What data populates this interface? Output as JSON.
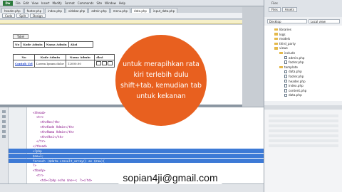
{
  "app": {
    "logo": "Dw",
    "menu": [
      "File",
      "Edit",
      "View",
      "Insert",
      "Modify",
      "Format",
      "Commands",
      "Site",
      "Window",
      "Help"
    ]
  },
  "tabs": [
    "header.php",
    "footer.php",
    "index.php",
    "sidebar.php",
    "admin.php",
    "menu.php",
    "data.php",
    "input_data.php"
  ],
  "active_tab_index": 6,
  "toolbar": {
    "code_label": "Code",
    "split_label": "Split",
    "design_label": "Design"
  },
  "design": {
    "label_box": "Tabel",
    "table1_headers": [
      "No",
      "Kode Admin",
      "Nama Admin",
      "Aksi"
    ],
    "table2_headers": [
      "No",
      "Kode Admin",
      "Nama Admin",
      "Aksi"
    ],
    "table2_row": [
      "Contoh Url",
      "Lorem Ipsum dolor",
      "12000.00",
      "",
      "",
      ""
    ]
  },
  "code_lines": [
    {
      "n": "",
      "text": "<thead>",
      "sel": false
    },
    {
      "n": "",
      "text": "  <tr>",
      "sel": false
    },
    {
      "n": "",
      "text": "    <th>No</th>",
      "sel": false
    },
    {
      "n": "",
      "text": "    <th>Kode Admin</th>",
      "sel": false
    },
    {
      "n": "",
      "text": "    <th>Nama Admin</th>",
      "sel": false
    },
    {
      "n": "",
      "text": "    <th>Aksi</th>",
      "sel": false
    },
    {
      "n": "",
      "text": "  </tr>",
      "sel": false
    },
    {
      "n": "",
      "text": "</thead>",
      "sel": false
    },
    {
      "n": "",
      "text": "<?php",
      "sel": true
    },
    {
      "n": "",
      "text": "$no=1;",
      "sel": true
    },
    {
      "n": "",
      "text": "foreach ($data->result_array() as $row){",
      "sel": true
    },
    {
      "n": "",
      "text": "?>",
      "sel": false
    },
    {
      "n": "",
      "text": "<tbody>",
      "sel": false
    },
    {
      "n": "",
      "text": "  <tr>",
      "sel": false
    },
    {
      "n": "",
      "text": "    <td><?php echo $no++; ?></td>",
      "sel": false
    }
  ],
  "files_panel": {
    "title": "Files",
    "tabs": [
      "Files",
      "Assets"
    ],
    "site_select": "Desktop",
    "view_select": "Local view",
    "tree": [
      {
        "name": "libraries",
        "kind": "folder",
        "indent": 2
      },
      {
        "name": "logs",
        "kind": "folder",
        "indent": 2
      },
      {
        "name": "models",
        "kind": "folder",
        "indent": 2
      },
      {
        "name": "third_party",
        "kind": "folder",
        "indent": 2
      },
      {
        "name": "views",
        "kind": "folder",
        "indent": 2
      },
      {
        "name": "include",
        "kind": "folder",
        "indent": 3
      },
      {
        "name": "admin.php",
        "kind": "file",
        "indent": 4
      },
      {
        "name": "footer.php",
        "kind": "file",
        "indent": 4
      },
      {
        "name": "template",
        "kind": "folder",
        "indent": 3
      },
      {
        "name": "data.php",
        "kind": "file",
        "indent": 4
      },
      {
        "name": "footer.php",
        "kind": "file",
        "indent": 4
      },
      {
        "name": "header.php",
        "kind": "file",
        "indent": 4
      },
      {
        "name": "index.php",
        "kind": "file",
        "indent": 4
      },
      {
        "name": "content.php",
        "kind": "file",
        "indent": 4
      },
      {
        "name": "data.php",
        "kind": "file",
        "indent": 4
      }
    ]
  },
  "overlay": {
    "bubble_text": "untuk merapihkan rata kiri terlebih dulu shift+tab, kemudian tab untuk kekanan",
    "email": "sopian4ji@gmail.com"
  },
  "colors": {
    "bubble": "#e8601f",
    "selection": "#3d7ad6",
    "link": "#1b40c8"
  }
}
